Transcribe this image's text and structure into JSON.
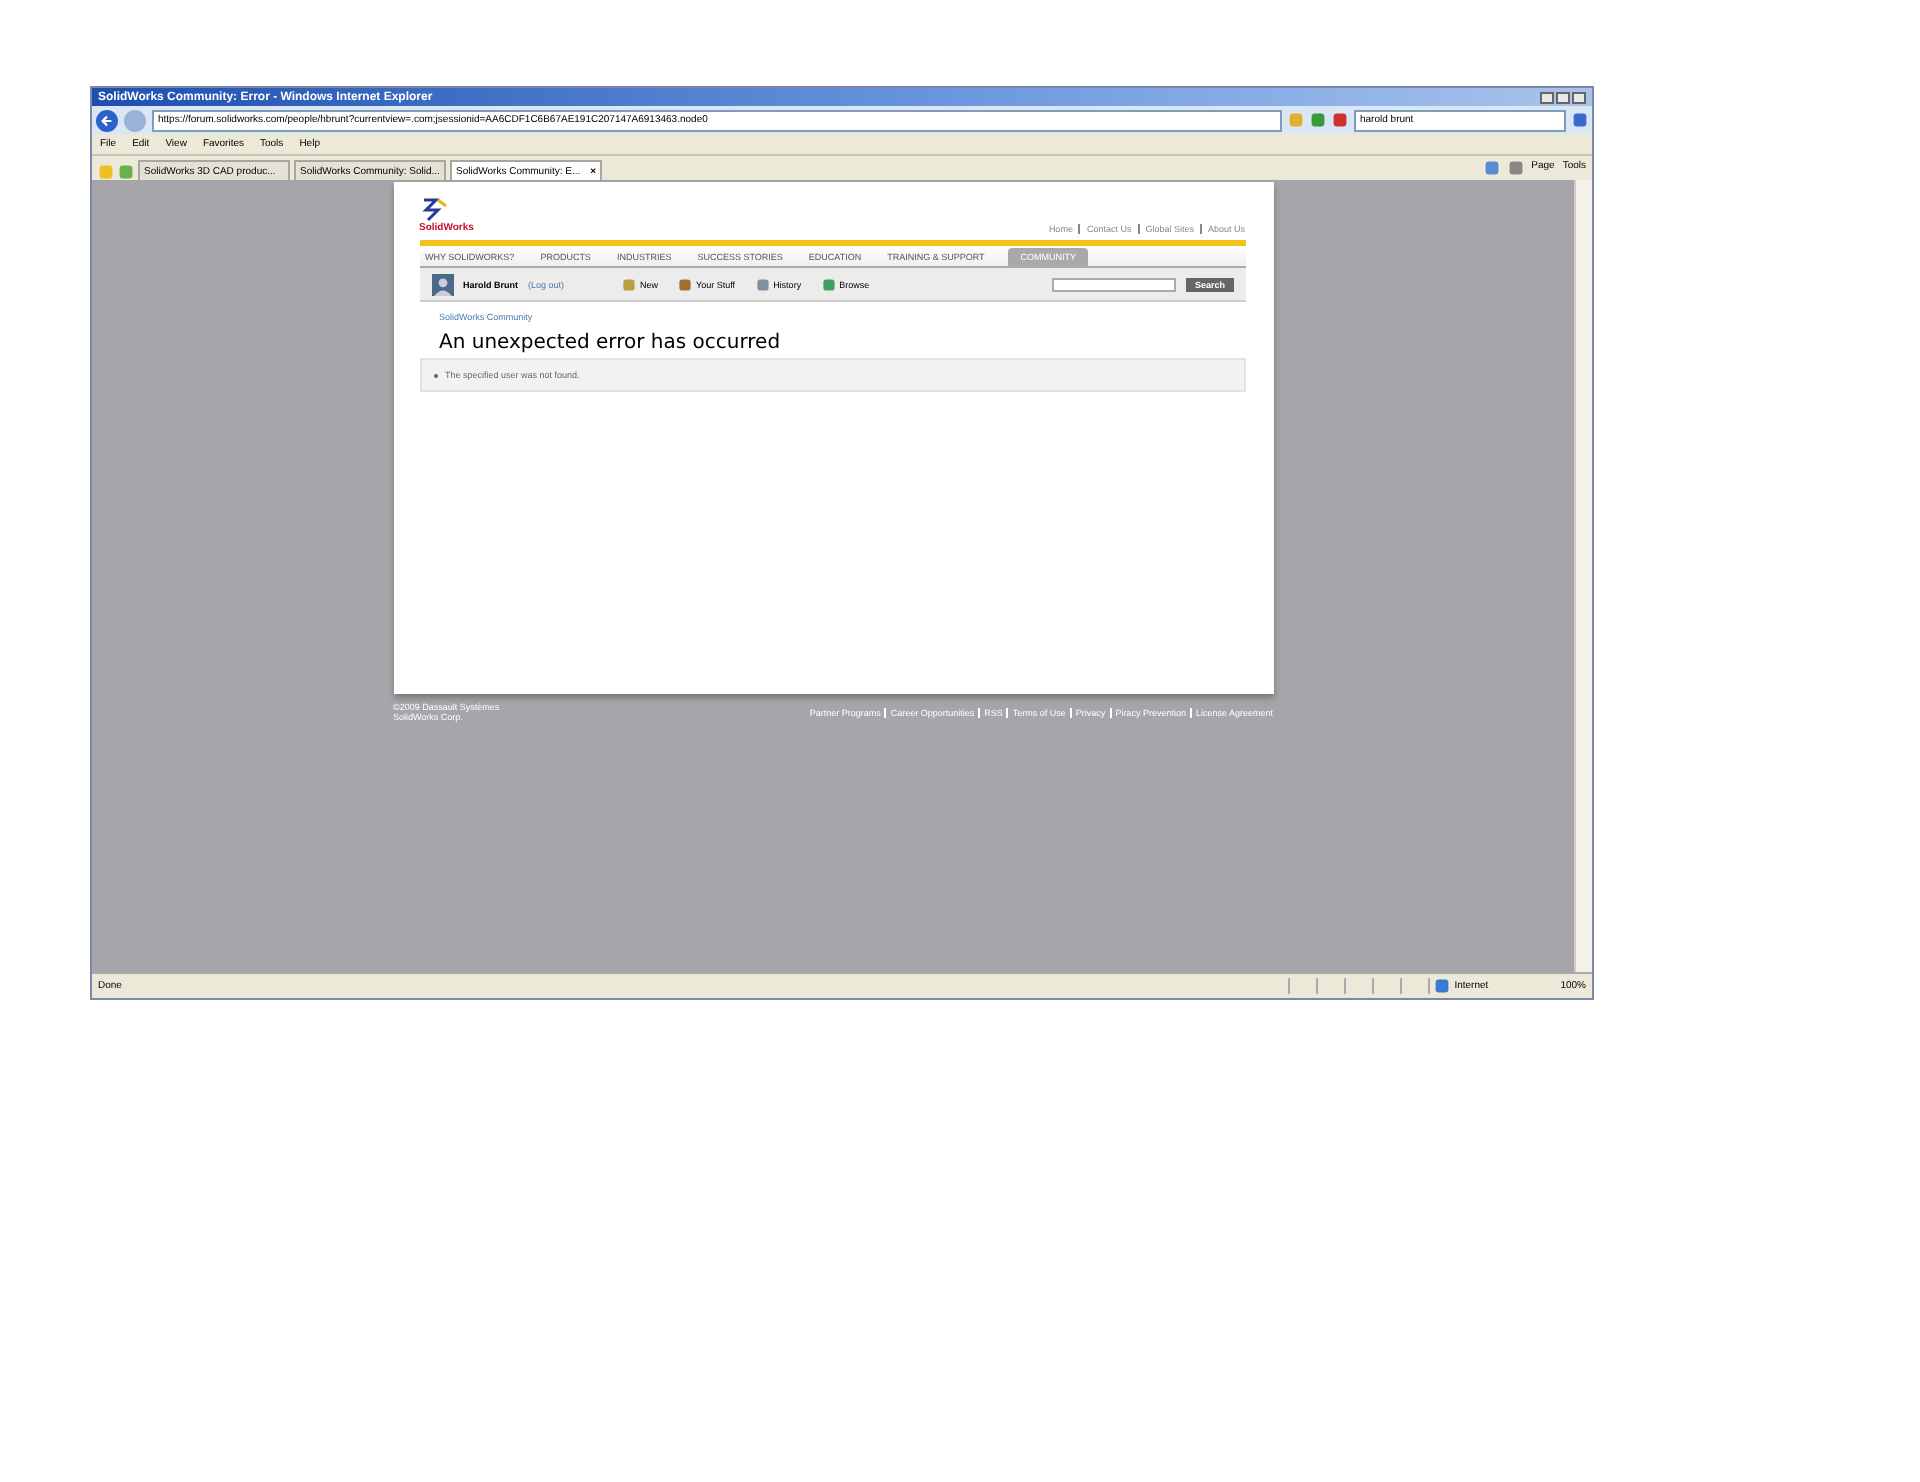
{
  "window": {
    "title": "SolidWorks Community: Error - Windows Internet Explorer"
  },
  "address_bar": {
    "url": "https://forum.solidworks.com/people/hbrunt?currentview=.com;jsessionid=AA6CDF1C6B67AE191C207147A6913463.node0"
  },
  "search_box": {
    "value": "harold brunt"
  },
  "menu": [
    "File",
    "Edit",
    "View",
    "Favorites",
    "Tools",
    "Help"
  ],
  "tabs": [
    {
      "label": "SolidWorks 3D CAD produc...",
      "selected": false
    },
    {
      "label": "SolidWorks Community: Solid...",
      "selected": false
    },
    {
      "label": "SolidWorks Community: E...",
      "selected": true,
      "close": "×"
    }
  ],
  "command_bar": [
    "Page",
    "Tools"
  ],
  "site": {
    "logo": "SolidWorks",
    "top_links": [
      "Home",
      "Contact Us",
      "Global Sites",
      "About Us"
    ],
    "nav": [
      {
        "label": "WHY SOLIDWORKS?",
        "selected": false
      },
      {
        "label": "PRODUCTS",
        "selected": false
      },
      {
        "label": "INDUSTRIES",
        "selected": false
      },
      {
        "label": "SUCCESS STORIES",
        "selected": false
      },
      {
        "label": "EDUCATION",
        "selected": false
      },
      {
        "label": "TRAINING & SUPPORT",
        "selected": false
      },
      {
        "label": "COMMUNITY",
        "selected": true
      }
    ],
    "user": {
      "name": "Harold Brunt",
      "logout": "(Log out)"
    },
    "actions": [
      "New",
      "Your Stuff",
      "History",
      "Browse"
    ],
    "search_button": "Search",
    "breadcrumb": "SolidWorks Community",
    "heading": "An unexpected error has occurred",
    "errors": [
      "The specified user was not found."
    ],
    "footer": {
      "copyright": [
        "©2009 Dassault Systèmes",
        "SolidWorks Corp."
      ],
      "links": [
        "Partner Programs",
        "Career Opportunities",
        "RSS",
        "Terms of Use",
        "Privacy",
        "Piracy Prevention",
        "License Agreement"
      ]
    }
  },
  "status_bar": {
    "text": "Done",
    "zone": "Internet",
    "zoom": "100%"
  }
}
